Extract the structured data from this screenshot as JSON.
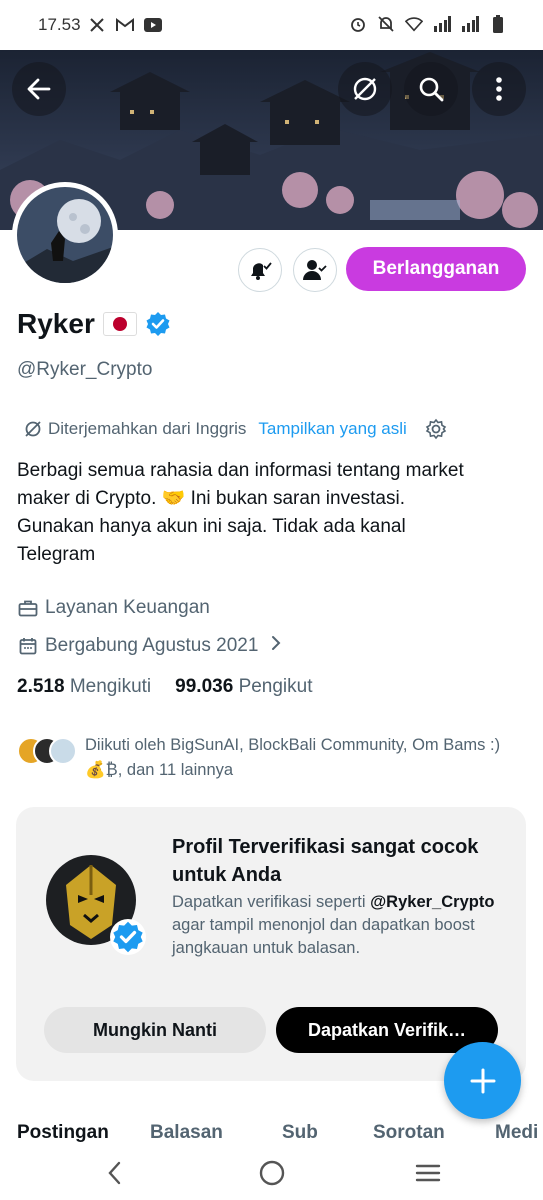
{
  "status_bar": {
    "time": "17.53",
    "left_icons": [
      "x-icon",
      "mail-icon",
      "youtube-icon"
    ],
    "right_icons": [
      "alarm-icon",
      "mute-icon",
      "wifi-icon",
      "signal-icon",
      "signal-icon",
      "battery-icon"
    ]
  },
  "header": {
    "back_icon": "arrow-left-icon",
    "translate_icon": "translate-icon",
    "search_icon": "search-icon",
    "more_icon": "more-vertical-icon"
  },
  "profile": {
    "name": "Ryker",
    "flag_emoji": "🇯🇵",
    "verified": true,
    "handle": "@Ryker_Crypto",
    "subscribe_label": "Berlangganan",
    "translation": {
      "label": "Diterjemahkan dari Inggris",
      "show_original": "Tampilkan yang asli"
    },
    "bio": "Berbagi semua rahasia dan informasi tentang market maker di Crypto. 🤝 Ini bukan saran investasi. Gunakan hanya akun ini saja. Tidak ada kanal Telegram",
    "category": "Layanan Keuangan",
    "joined": "Bergabung Agustus 2021",
    "following_count": "2.518",
    "following_label": "Mengikuti",
    "followers_count": "99.036",
    "followers_label": "Pengikut",
    "followed_by": "Diikuti oleh BigSunAI, BlockBali Community, Om Bams :) 💰₿, dan 11 lainnya"
  },
  "verified_card": {
    "title": "Profil Terverifikasi sangat cocok untuk Anda",
    "desc_before": "Dapatkan verifikasi seperti ",
    "desc_handle": "@Ryker_Crypto",
    "desc_after": " agar tampil menonjol dan dapatkan boost jangkauan untuk balasan.",
    "later_label": "Mungkin Nanti",
    "verify_label": "Dapatkan Verifik…"
  },
  "tabs": [
    "Postingan",
    "Balasan",
    "Sub",
    "Sorotan",
    "Medi"
  ],
  "active_tab": 0,
  "colors": {
    "accent": "#1d9bf0",
    "subscribe": "#c93be0",
    "muted": "#536471"
  },
  "nav_icons": [
    "back-icon",
    "home-icon",
    "menu-icon"
  ]
}
